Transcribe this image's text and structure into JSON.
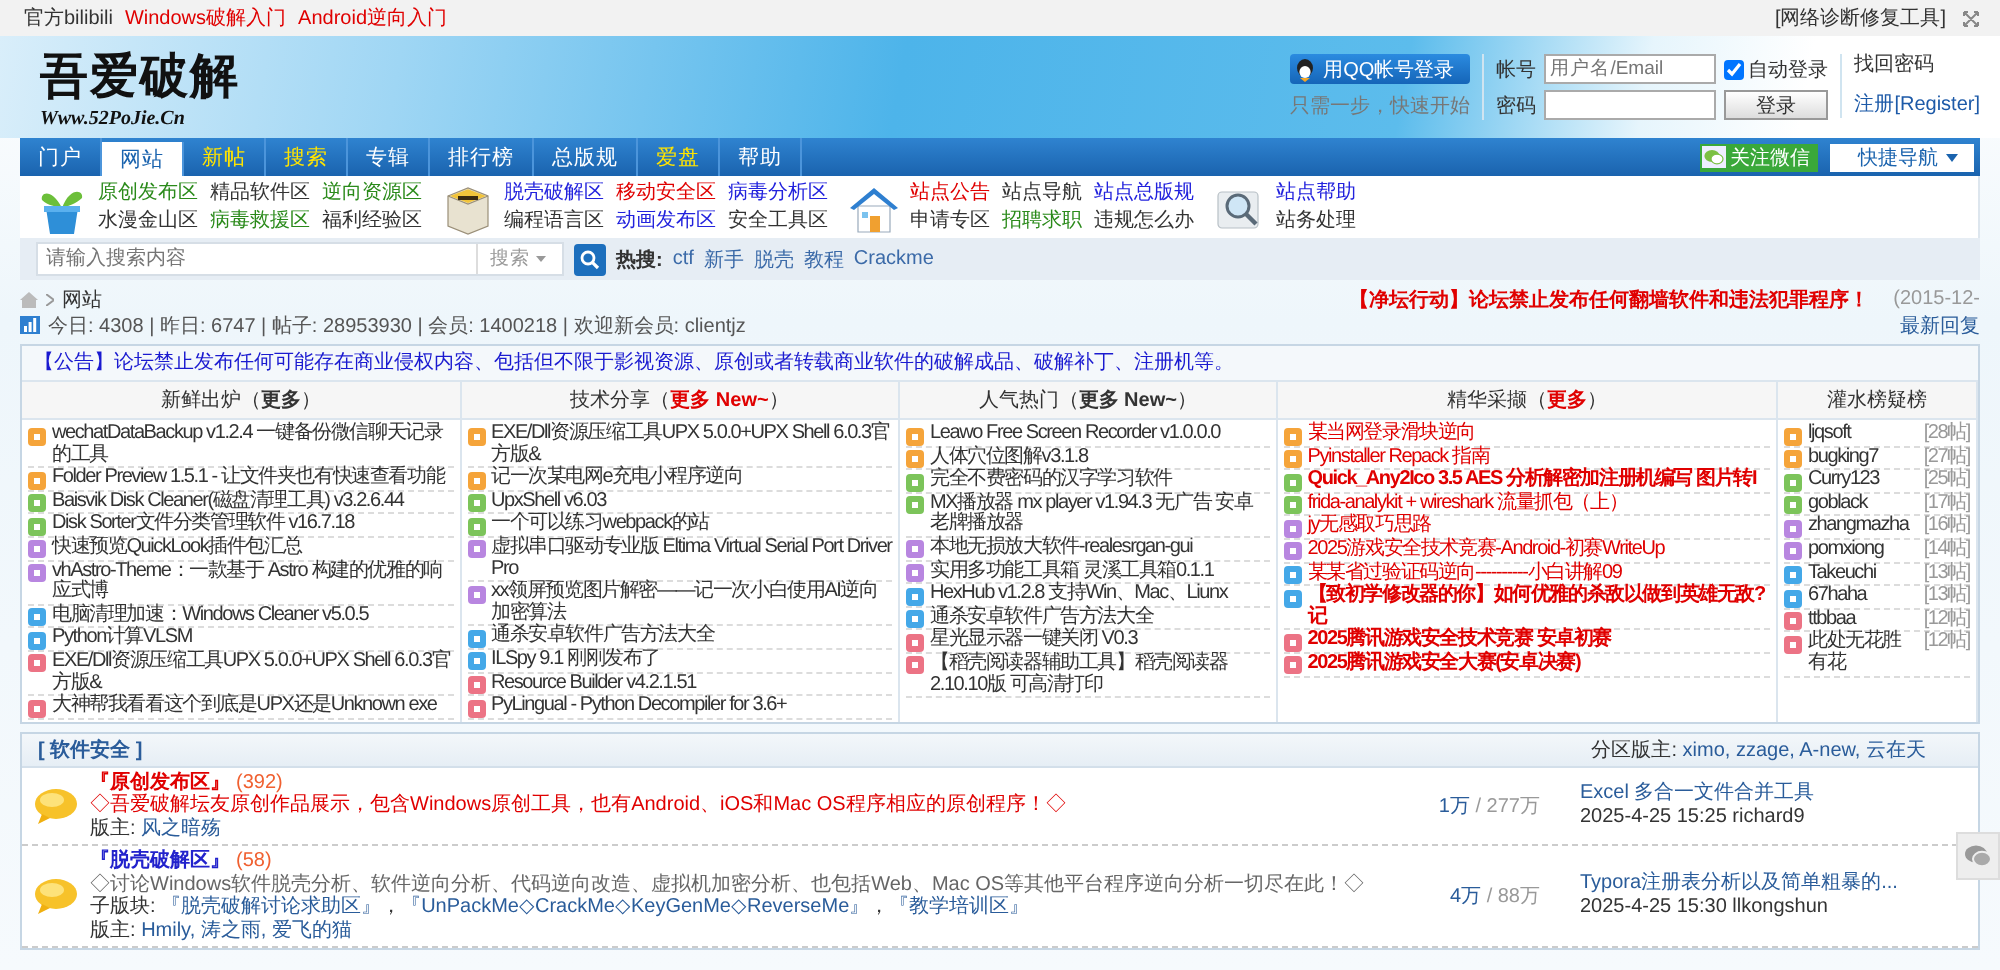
{
  "top_bar": {
    "links": [
      {
        "text": "官方bilibili",
        "color": "#333333"
      },
      {
        "text": "Windows破解入门",
        "color": "#e00000"
      },
      {
        "text": "Android逆向入门",
        "color": "#e00000"
      }
    ],
    "tool_link": "[网络诊断修复工具]"
  },
  "header": {
    "logo_title": "吾爱破解",
    "logo_url": "Www.52PoJie.Cn",
    "qq_login": "用QQ帐号登录",
    "qq_hint": "只需一步，快速开始",
    "account_label": "帐号",
    "account_placeholder": "用户名/Email",
    "remember": {
      "label": "自动登录",
      "checked": true
    },
    "forgot": "找回密码",
    "password_label": "密码",
    "login_button": "登录",
    "register": "注册[Register]"
  },
  "nav": {
    "items": [
      {
        "label": "门户",
        "selected": false,
        "highlight": false
      },
      {
        "label": "网站",
        "selected": true,
        "highlight": false
      },
      {
        "label": "新帖",
        "selected": false,
        "highlight": true
      },
      {
        "label": "搜索",
        "selected": false,
        "highlight": true
      },
      {
        "label": "专辑",
        "selected": false,
        "highlight": false
      },
      {
        "label": "排行榜",
        "selected": false,
        "highlight": false
      },
      {
        "label": "总版规",
        "selected": false,
        "highlight": false
      },
      {
        "label": "爱盘",
        "selected": false,
        "highlight": true
      },
      {
        "label": "帮助",
        "selected": false,
        "highlight": false
      }
    ],
    "wechat_button": "关注微信",
    "quick_nav": "快捷导航"
  },
  "quick_links": {
    "groups": [
      {
        "kind": "plant",
        "links": [
          {
            "text": "原创发布区",
            "color": "#2a8a1a"
          },
          {
            "text": "精品软件区",
            "color": "#333333"
          },
          {
            "text": "逆向资源区",
            "color": "#2a8a1a"
          },
          {
            "text": "水漫金山区",
            "color": "#333333"
          },
          {
            "text": "病毒救援区",
            "color": "#2a8a1a"
          },
          {
            "text": "福利经验区",
            "color": "#333333"
          }
        ]
      },
      {
        "kind": "box",
        "links": [
          {
            "text": "脱壳破解区",
            "color": "#2222dd"
          },
          {
            "text": "移动安全区",
            "color": "#e00000"
          },
          {
            "text": "病毒分析区",
            "color": "#2222dd"
          },
          {
            "text": "编程语言区",
            "color": "#333333"
          },
          {
            "text": "动画发布区",
            "color": "#2222dd"
          },
          {
            "text": "安全工具区",
            "color": "#333333"
          }
        ]
      },
      {
        "kind": "house",
        "links": [
          {
            "text": "站点公告",
            "color": "#e00000"
          },
          {
            "text": "站点导航",
            "color": "#333333"
          },
          {
            "text": "站点总版规",
            "color": "#2222dd"
          },
          {
            "text": "申请专区",
            "color": "#333333"
          },
          {
            "text": "招聘求职",
            "color": "#2a8a1a"
          },
          {
            "text": "违规怎么办",
            "color": "#333333"
          }
        ]
      },
      {
        "kind": "magnifier",
        "links": [
          {
            "text": "站点帮助",
            "color": "#2222dd"
          },
          {
            "text": "站务处理",
            "color": "#333333"
          }
        ]
      }
    ]
  },
  "search": {
    "placeholder": "请输入搜索内容",
    "scope": "搜索",
    "hot_label": "热搜:",
    "hot": [
      "ctf",
      "新手",
      "脱壳",
      "教程",
      "Crackme"
    ]
  },
  "breadcrumb": {
    "current": "网站"
  },
  "announcement": {
    "text": "【净坛行动】论坛禁止发布任何翻墙软件和违法犯罪程序！",
    "date": "(2015-12-"
  },
  "stats": "今日: 4308 | 昨日: 6747 | 帖子: 28953930 | 会员: 1400218 | 欢迎新会员: clientjz",
  "latest_replies": "最新回复",
  "board": {
    "notice": "【公告】论坛禁止发布任何可能存在商业侵权内容、包括但不限于影视资源、原创或者转载商业软件的破解成品、破解补丁、注册机等。",
    "columns": [
      {
        "kind": "topics",
        "prefix": "新鲜出炉（",
        "more": "更多",
        "suffix": "）",
        "more_highlight": false,
        "items": [
          {
            "title": "wechatDataBackup v1.2.4 一键备份微信聊天记录的工具",
            "color": "#f5a43a"
          },
          {
            "title": "Folder Preview 1.5.1 - 让文件夹也有快速查看功能",
            "color": "#f5a43a"
          },
          {
            "title": "Baisvik Disk Cleaner(磁盘清理工具) v3.2.6.44",
            "color": "#7cc45a"
          },
          {
            "title": "Disk Sorter文件分类管理软件 v16.7.18",
            "color": "#7cc45a"
          },
          {
            "title": "快速预览QuickLook插件包汇总",
            "color": "#b886e0"
          },
          {
            "title": "vhAstro-Theme：一款基于 Astro 构建的优雅的响应式博",
            "color": "#b886e0"
          },
          {
            "title": "电脑清理加速：Windows Cleaner v5.0.5",
            "color": "#44a8e8"
          },
          {
            "title": "Python计算VLSM",
            "color": "#44a8e8"
          },
          {
            "title": "EXE/Dll资源压缩工具UPX 5.0.0+UPX Shell 6.0.3官方版&",
            "color": "#ec7385"
          },
          {
            "title": "大神帮我看看这个到底是UPX还是Unknown exe",
            "color": "#ec7385"
          }
        ]
      },
      {
        "kind": "topics",
        "prefix": "技术分享（",
        "more": "更多 New~",
        "suffix": "）",
        "more_highlight": true,
        "items": [
          {
            "title": "EXE/Dll资源压缩工具UPX 5.0.0+UPX Shell 6.0.3官方版&",
            "color": "#f5a43a"
          },
          {
            "title": "记一次某电网e充电小程序逆向",
            "color": "#f5a43a"
          },
          {
            "title": "UpxShell v6.03",
            "color": "#7cc45a"
          },
          {
            "title": "一个可以练习webpack的站",
            "color": "#7cc45a"
          },
          {
            "title": "虚拟串口驱动专业版 Eltima Virtual Serial Port Driver Pro",
            "color": "#b886e0"
          },
          {
            "title": "xx领屏预览图片解密——记一次小白使用AI逆向加密算法",
            "color": "#b886e0"
          },
          {
            "title": "通杀安卓软件广告方法大全",
            "color": "#44a8e8"
          },
          {
            "title": "ILSpy 9.1 刚刚发布了",
            "color": "#44a8e8"
          },
          {
            "title": "Resource Builder v4.2.1.51",
            "color": "#ec7385"
          },
          {
            "title": "PyLingual - Python Decompiler for 3.6+",
            "color": "#ec7385"
          }
        ]
      },
      {
        "kind": "topics",
        "prefix": "人气热门（",
        "more": "更多 New~",
        "suffix": "）",
        "more_highlight": false,
        "items": [
          {
            "title": "Leawo Free Screen Recorder v1.0.0.0",
            "color": "#f5a43a"
          },
          {
            "title": "人体穴位图解v3.1.8",
            "color": "#f5a43a"
          },
          {
            "title": "完全不费密码的汉字学习软件",
            "color": "#7cc45a"
          },
          {
            "title": "MX播放器 mx player v1.94.3 无广告 安卓老牌播放器",
            "color": "#7cc45a"
          },
          {
            "title": "本地无损放大软件-realesrgan-gui",
            "color": "#b886e0"
          },
          {
            "title": "实用多功能工具箱 灵溪工具箱0.1.1",
            "color": "#b886e0"
          },
          {
            "title": "HexHub v1.2.8 支持Win、Mac、Liunx",
            "color": "#44a8e8"
          },
          {
            "title": "通杀安卓软件广告方法大全",
            "color": "#44a8e8"
          },
          {
            "title": "星光显示器一键关闭 V0.3",
            "color": "#ec7385"
          },
          {
            "title": "【稻壳阅读器辅助工具】稻壳阅读器2.10.10版 可高清打印",
            "color": "#ec7385"
          }
        ]
      },
      {
        "kind": "featured",
        "prefix": "精华采撷（",
        "more": "更多",
        "suffix": "）",
        "more_highlight": true,
        "items": [
          {
            "title": "某当网登录滑块逆向",
            "color": "#f5a43a",
            "bold": false
          },
          {
            "title": "Pyinstaller Repack 指南",
            "color": "#f5a43a",
            "bold": false
          },
          {
            "title": "Quick_Any2Ico 3.5 AES 分析解密加注册机编写 图片转I",
            "color": "#7cc45a",
            "bold": true
          },
          {
            "title": "frida-analykit + wireshark 流量抓包（上）",
            "color": "#7cc45a",
            "bold": false
          },
          {
            "title": "jy无感取巧思路",
            "color": "#b886e0",
            "bold": false
          },
          {
            "title": "2025游戏安全技术竞赛-Android-初赛WriteUp",
            "color": "#b886e0",
            "bold": false
          },
          {
            "title": "某某省过验证码逆向----------小白讲解09",
            "color": "#44a8e8",
            "bold": false
          },
          {
            "title": "【致初学修改器的你】如何优雅的杀敌以做到英雄无敌?记",
            "color": "#44a8e8",
            "bold": true
          },
          {
            "title": "2025腾讯游戏安全技术竞赛 安卓初赛",
            "color": "#ec7385",
            "bold": true
          },
          {
            "title": "2025腾讯游戏安全大赛(安卓决赛)",
            "color": "#ec7385",
            "bold": true
          }
        ]
      },
      {
        "kind": "users",
        "title": "灌水榜疑榜",
        "items": [
          {
            "name": "ljqsoft",
            "count": "[28帖]",
            "color": "#f5a43a"
          },
          {
            "name": "bugking7",
            "count": "[27帖]",
            "color": "#f5a43a"
          },
          {
            "name": "Curry123",
            "count": "[25帖]",
            "color": "#7cc45a"
          },
          {
            "name": "goblack",
            "count": "[17帖]",
            "color": "#7cc45a"
          },
          {
            "name": "zhangmazha",
            "count": "[16帖]",
            "color": "#b886e0"
          },
          {
            "name": "pomxiong",
            "count": "[14帖]",
            "color": "#b886e0"
          },
          {
            "name": "Takeuchi",
            "count": "[13帖]",
            "color": "#44a8e8"
          },
          {
            "name": "67haha",
            "count": "[13帖]",
            "color": "#44a8e8"
          },
          {
            "name": "ttbbaa",
            "count": "[12帖]",
            "color": "#ec7385"
          },
          {
            "name": "此处无花胜有花",
            "count": "[12帖]",
            "color": "#ec7385"
          }
        ]
      }
    ]
  },
  "section": {
    "title": "[ 软件安全 ]",
    "moderators_label": "分区版主:",
    "moderators": "ximo, zzage, A-new, 云在天"
  },
  "forums": [
    {
      "name": "『原创发布区』",
      "today": "(392)",
      "highlight": true,
      "description": "◇吾爱破解坛友原创作品展示，包含Windows原创工具，也有Android、iOS和Mac OS程序相应的原创程序！◇",
      "moderators_label": "版主:",
      "moderators": "风之暗殇",
      "threads": "1万",
      "posts": "/ 277万",
      "last_title": "Excel 多合一文件合并工具",
      "last_info": "2025-4-25 15:25 richard9"
    },
    {
      "name": "『脱壳破解区』",
      "today": "(58)",
      "highlight": false,
      "description": "◇讨论Windows软件脱壳分析、软件逆向分析、代码逆向改造、虚拟机加密分析、也包括Web、Mac OS等其他平台程序逆向分析一切尽在此！◇",
      "subforums_label": "子版块:",
      "subforums": [
        "『脱壳破解讨论求助区』",
        "『UnPackMe◇CrackMe◇KeyGenMe◇ReverseMe』",
        "『教学培训区』"
      ],
      "subforum_separator": "，",
      "moderators_label": "版主:",
      "moderators": "Hmily, 涛之雨, 爱飞的猫",
      "threads": "4万",
      "posts": "/ 88万",
      "last_title": "Typora注册表分析以及简单粗暴的...",
      "last_info": "2025-4-25 15:30 llkongshun"
    }
  ]
}
